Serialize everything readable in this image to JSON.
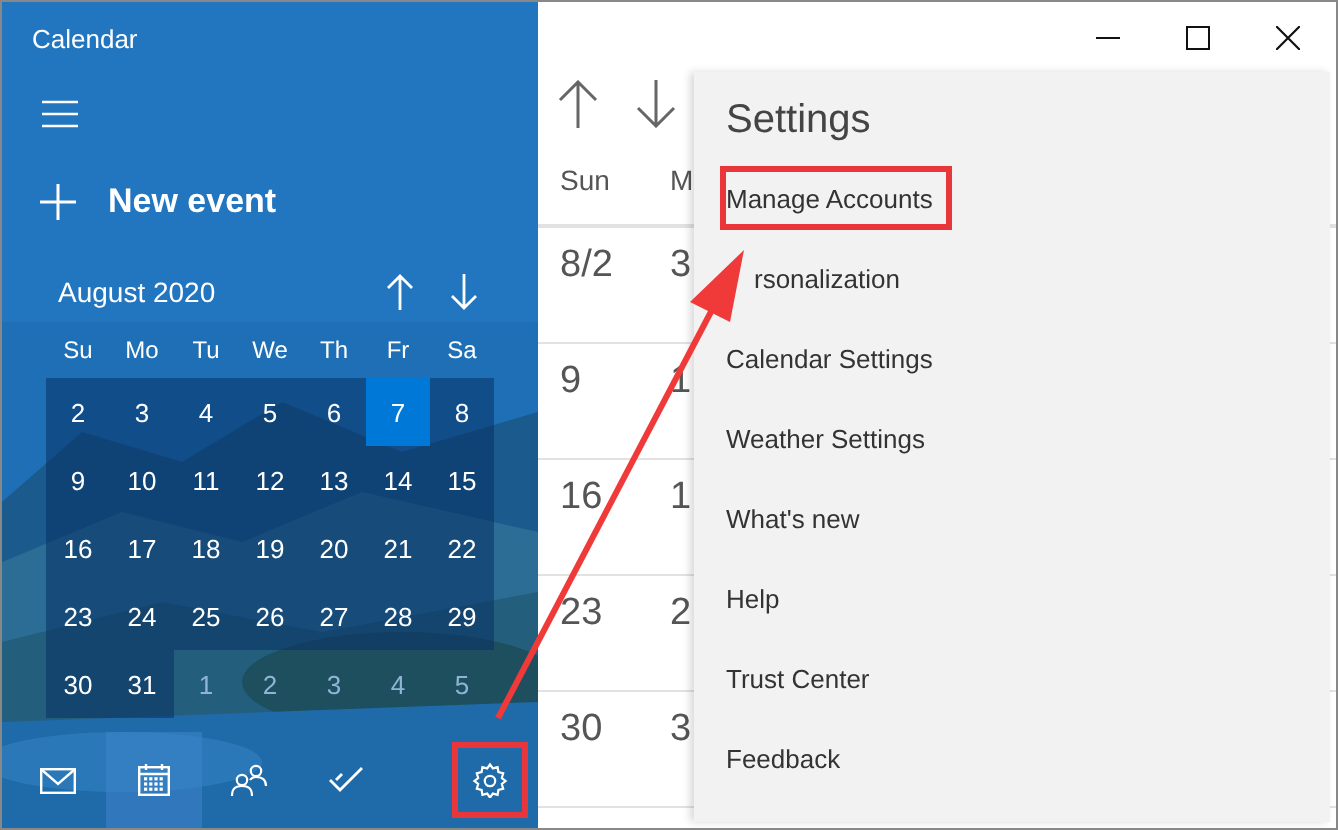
{
  "window": {
    "title": "Calendar"
  },
  "sidebar": {
    "new_event": "New event",
    "mini_calendar": {
      "month": "August 2020",
      "weekdays": [
        "Su",
        "Mo",
        "Tu",
        "We",
        "Th",
        "Fr",
        "Sa"
      ],
      "weeks": [
        [
          {
            "day": "2",
            "in_month": true,
            "selected": false
          },
          {
            "day": "3",
            "in_month": true,
            "selected": false
          },
          {
            "day": "4",
            "in_month": true,
            "selected": false
          },
          {
            "day": "5",
            "in_month": true,
            "selected": false
          },
          {
            "day": "6",
            "in_month": true,
            "selected": false
          },
          {
            "day": "7",
            "in_month": true,
            "selected": true
          },
          {
            "day": "8",
            "in_month": true,
            "selected": false
          }
        ],
        [
          {
            "day": "9",
            "in_month": true,
            "selected": false
          },
          {
            "day": "10",
            "in_month": true,
            "selected": false
          },
          {
            "day": "11",
            "in_month": true,
            "selected": false
          },
          {
            "day": "12",
            "in_month": true,
            "selected": false
          },
          {
            "day": "13",
            "in_month": true,
            "selected": false
          },
          {
            "day": "14",
            "in_month": true,
            "selected": false
          },
          {
            "day": "15",
            "in_month": true,
            "selected": false
          }
        ],
        [
          {
            "day": "16",
            "in_month": true,
            "selected": false
          },
          {
            "day": "17",
            "in_month": true,
            "selected": false
          },
          {
            "day": "18",
            "in_month": true,
            "selected": false
          },
          {
            "day": "19",
            "in_month": true,
            "selected": false
          },
          {
            "day": "20",
            "in_month": true,
            "selected": false
          },
          {
            "day": "21",
            "in_month": true,
            "selected": false
          },
          {
            "day": "22",
            "in_month": true,
            "selected": false
          }
        ],
        [
          {
            "day": "23",
            "in_month": true,
            "selected": false
          },
          {
            "day": "24",
            "in_month": true,
            "selected": false
          },
          {
            "day": "25",
            "in_month": true,
            "selected": false
          },
          {
            "day": "26",
            "in_month": true,
            "selected": false
          },
          {
            "day": "27",
            "in_month": true,
            "selected": false
          },
          {
            "day": "28",
            "in_month": true,
            "selected": false
          },
          {
            "day": "29",
            "in_month": true,
            "selected": false
          }
        ],
        [
          {
            "day": "30",
            "in_month": true,
            "selected": false
          },
          {
            "day": "31",
            "in_month": true,
            "selected": false
          },
          {
            "day": "1",
            "in_month": false,
            "selected": false
          },
          {
            "day": "2",
            "in_month": false,
            "selected": false
          },
          {
            "day": "3",
            "in_month": false,
            "selected": false
          },
          {
            "day": "4",
            "in_month": false,
            "selected": false
          },
          {
            "day": "5",
            "in_month": false,
            "selected": false
          }
        ]
      ]
    },
    "nav": [
      {
        "kind": "mail",
        "selected": false,
        "outlined": false
      },
      {
        "kind": "calendar",
        "selected": true,
        "outlined": false
      },
      {
        "kind": "people",
        "selected": false,
        "outlined": false
      },
      {
        "kind": "todo",
        "selected": false,
        "outlined": false
      },
      {
        "kind": "settings",
        "selected": false,
        "outlined": true
      }
    ]
  },
  "week_view": {
    "columns": [
      "Sun",
      "M"
    ],
    "rows": [
      [
        "8/2",
        "3"
      ],
      [
        "9",
        "1"
      ],
      [
        "16",
        "1"
      ],
      [
        "23",
        "2"
      ],
      [
        "30",
        "3"
      ]
    ]
  },
  "settings": {
    "title": "Settings",
    "items": [
      {
        "label": "Manage Accounts",
        "outlined": true,
        "covered_by_arrow": false
      },
      {
        "label": "rsonalization",
        "outlined": false,
        "covered_by_arrow": true
      },
      {
        "label": "Calendar Settings",
        "outlined": false,
        "covered_by_arrow": false
      },
      {
        "label": "Weather Settings",
        "outlined": false,
        "covered_by_arrow": false
      },
      {
        "label": "What's new",
        "outlined": false,
        "covered_by_arrow": false
      },
      {
        "label": "Help",
        "outlined": false,
        "covered_by_arrow": false
      },
      {
        "label": "Trust Center",
        "outlined": false,
        "covered_by_arrow": false
      },
      {
        "label": "Feedback",
        "outlined": false,
        "covered_by_arrow": false
      }
    ]
  }
}
